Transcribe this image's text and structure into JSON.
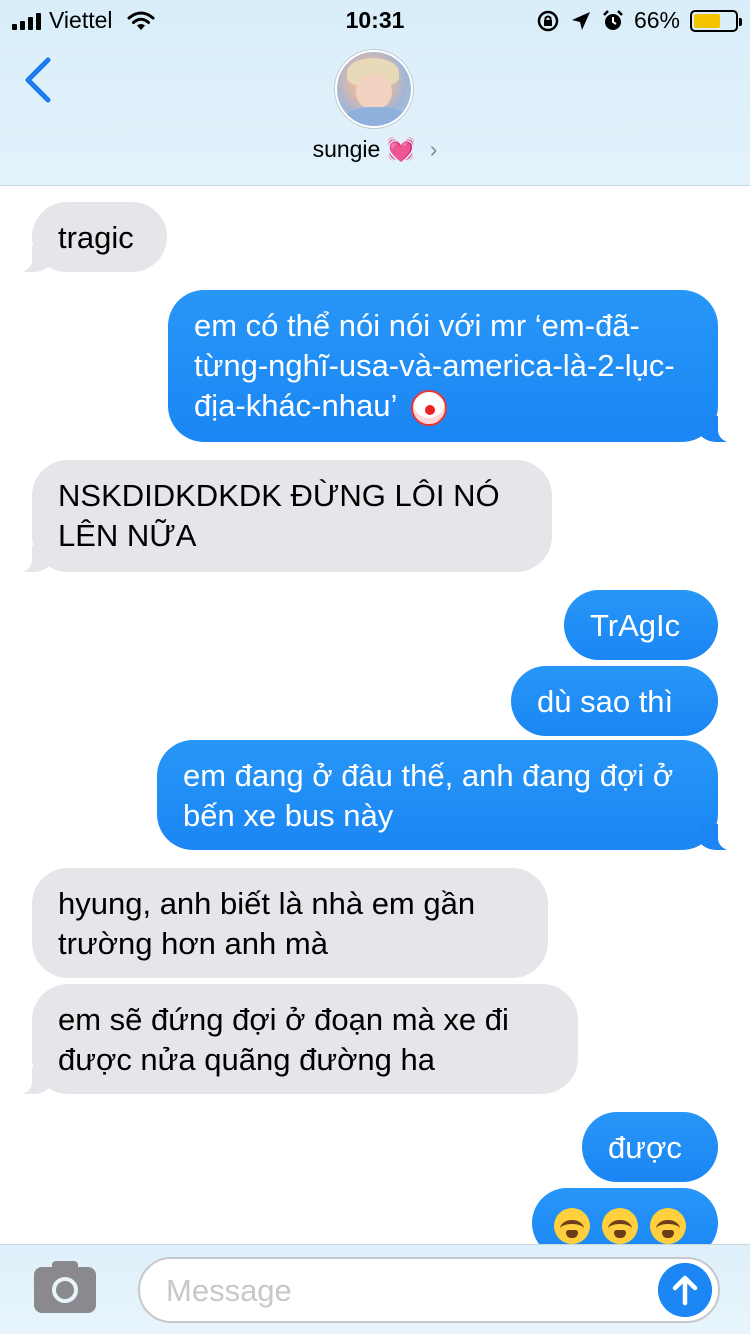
{
  "status_bar": {
    "carrier": "Viettel",
    "time": "10:31",
    "battery": "66%",
    "battery_level": 0.66,
    "icons": [
      "signal-icon",
      "wifi-icon",
      "lock-rotation-icon",
      "location-icon",
      "alarm-icon",
      "battery-icon"
    ]
  },
  "header": {
    "contact_name": "sungie",
    "contact_emoji": "💓",
    "chevron": "›",
    "icons": [
      "back-chevron-icon",
      "contact-avatar"
    ]
  },
  "messages": [
    {
      "side": "in",
      "text": "tragic"
    },
    {
      "side": "out",
      "text": "em có thể nói nói với mr ‘em-đã-từng-nghĩ-usa-và-america-là-2-lục-địa-khác-nhau’",
      "emoji": "clown-face-emoji"
    },
    {
      "side": "in",
      "text": "NSKDIDKDKDK ĐỪNG LÔI NÓ LÊN NỮA"
    },
    {
      "side": "out",
      "text": "TrAgIc"
    },
    {
      "side": "out",
      "text": "dù sao thì"
    },
    {
      "side": "out",
      "text": "em đang ở đâu thế, anh đang đợi ở bến xe bus này"
    },
    {
      "side": "in",
      "text": "hyung, anh biết là nhà em gần trường hơn anh mà"
    },
    {
      "side": "in",
      "text": "em sẽ đứng đợi ở đoạn mà xe đi được nửa quãng đường ha"
    },
    {
      "side": "out",
      "text": "được"
    },
    {
      "side": "out",
      "text": "",
      "emoji": "loudly-crying-face-emoji x3"
    }
  ],
  "composer": {
    "placeholder": "Message",
    "icons": [
      "camera-icon",
      "send-arrow-icon"
    ]
  },
  "colors": {
    "outgoing_bubble": "#1B86F4",
    "incoming_bubble": "#E5E5EA",
    "header_bg": "#DCEFFA",
    "accent": "#007AFF"
  }
}
